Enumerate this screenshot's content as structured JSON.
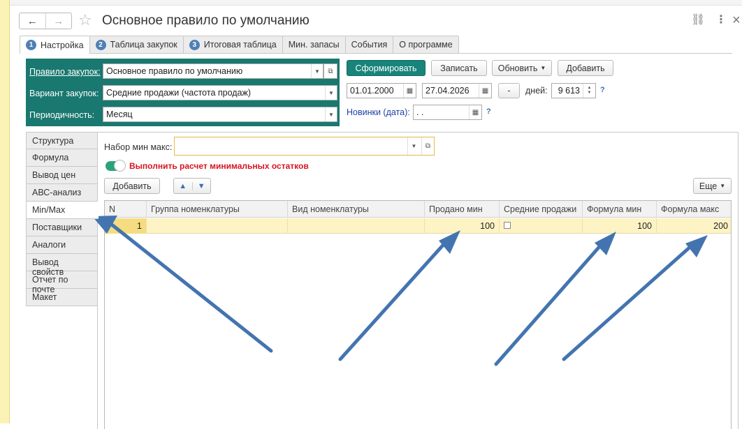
{
  "window": {
    "title": "Основное правило по умолчанию",
    "back_icon": "←",
    "forward_icon": "→",
    "star_icon": "☆",
    "link_icon": "⛓",
    "menu_icon": "⋮",
    "close_icon": "×"
  },
  "tabs": [
    {
      "num": "1",
      "label": "Настройка"
    },
    {
      "num": "2",
      "label": "Таблица закупок"
    },
    {
      "num": "3",
      "label": "Итоговая таблица"
    },
    {
      "num": "",
      "label": "Мин. запасы"
    },
    {
      "num": "",
      "label": "События"
    },
    {
      "num": "",
      "label": "О программе"
    }
  ],
  "settings": {
    "rule_label": "Правило закупок:",
    "rule_value": "Основное правило по умолчанию",
    "variant_label": "Вариант закупок:",
    "variant_value": "Средние продажи (частота продаж)",
    "period_label": "Периодичность:",
    "period_value": "Месяц"
  },
  "actions": {
    "generate": "Сформировать",
    "save": "Записать",
    "refresh": "Обновить",
    "add": "Добавить",
    "date_from": "01.01.2000",
    "date_to": "27.04.2026",
    "minus": "-",
    "days_label": "дней:",
    "days_value": "9 613",
    "help": "?",
    "new_label": "Новинки (дата):",
    "new_value": " .  ."
  },
  "side_menu": [
    "Структура",
    "Формула",
    "Вывод цен",
    "АВС-анализ",
    "Min/Max",
    "Поставщики",
    "Аналоги",
    "Вывод свойств",
    "Отчет по почте",
    "Макет"
  ],
  "minmax": {
    "set_label": "Набор мин макс:",
    "set_value": "",
    "toggle_label": "Выполнить расчет минимальных остатков",
    "add_button": "Добавить",
    "up_icon": "▲",
    "down_icon": "▼",
    "more_button": "Еще",
    "columns": [
      "N",
      "Группа номенклатуры",
      "Вид номенклатуры",
      "Продано мин",
      "Средние продажи",
      "Формула мин",
      "Формула макс"
    ],
    "rows": [
      {
        "n": "1",
        "group": "",
        "kind": "",
        "sold_min": "100",
        "avg_sales": false,
        "formula_min": "100",
        "formula_max": "200"
      }
    ]
  },
  "colors": {
    "accent_teal": "#19786f",
    "primary_button": "#18847a",
    "toggle_on": "#2aa37b",
    "warning_text": "#d8141e",
    "link_blue": "#1f3fa8",
    "row_highlight": "#fdf3c4",
    "arrow": "#4474b0"
  }
}
